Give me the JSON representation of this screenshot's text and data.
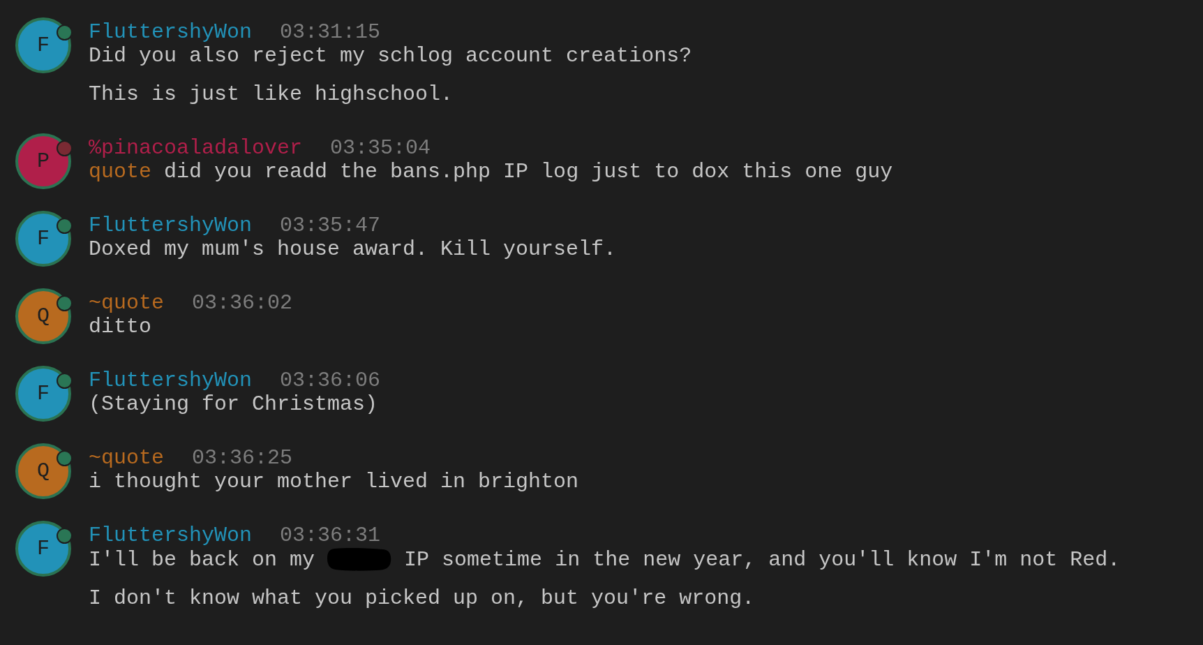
{
  "messages": [
    {
      "author": {
        "name": "FluttershyWon",
        "initial": "F",
        "color": "#2292b8"
      },
      "status_dot": {
        "color": "#2a7655"
      },
      "time": "03:31:15",
      "lines": [
        {
          "parts": [
            {
              "kind": "text",
              "text": "Did you also reject my schlog account creations?"
            }
          ]
        },
        {
          "parts": [
            {
              "kind": "text",
              "text": "This is just like highschool."
            }
          ]
        }
      ]
    },
    {
      "author": {
        "name": "%pinacoaladalover",
        "initial": "P",
        "color": "#b01f4a"
      },
      "status_dot": {
        "color": "#7a2a33"
      },
      "time": "03:35:04",
      "lines": [
        {
          "parts": [
            {
              "kind": "mention",
              "text": "quote",
              "color": "#b86a1f"
            },
            {
              "kind": "text",
              "text": "did you readd the bans.php IP log just to dox this one guy"
            }
          ]
        }
      ]
    },
    {
      "author": {
        "name": "FluttershyWon",
        "initial": "F",
        "color": "#2292b8"
      },
      "status_dot": {
        "color": "#2a7655"
      },
      "time": "03:35:47",
      "lines": [
        {
          "parts": [
            {
              "kind": "text",
              "text": "Doxed my mum's house award. Kill yourself."
            }
          ]
        }
      ]
    },
    {
      "author": {
        "name": "~quote",
        "initial": "Q",
        "color": "#b86a1f"
      },
      "status_dot": {
        "color": "#2a7655"
      },
      "time": "03:36:02",
      "lines": [
        {
          "parts": [
            {
              "kind": "text",
              "text": "ditto"
            }
          ]
        }
      ]
    },
    {
      "author": {
        "name": "FluttershyWon",
        "initial": "F",
        "color": "#2292b8"
      },
      "status_dot": {
        "color": "#2a7655"
      },
      "time": "03:36:06",
      "lines": [
        {
          "parts": [
            {
              "kind": "text",
              "text": "(Staying for Christmas)"
            }
          ]
        }
      ]
    },
    {
      "author": {
        "name": "~quote",
        "initial": "Q",
        "color": "#b86a1f"
      },
      "status_dot": {
        "color": "#2a7655"
      },
      "time": "03:36:25",
      "lines": [
        {
          "parts": [
            {
              "kind": "text",
              "text": "i thought your mother lived in brighton"
            }
          ]
        }
      ]
    },
    {
      "author": {
        "name": "FluttershyWon",
        "initial": "F",
        "color": "#2292b8"
      },
      "status_dot": {
        "color": "#2a7655"
      },
      "time": "03:36:31",
      "lines": [
        {
          "parts": [
            {
              "kind": "text",
              "text": "I'll be back on my"
            },
            {
              "kind": "redaction"
            },
            {
              "kind": "text",
              "text": "IP sometime in the new year, and you'll know I'm not Red."
            }
          ]
        },
        {
          "parts": [
            {
              "kind": "text",
              "text": "I don't know what you picked up on, but you're wrong."
            }
          ]
        }
      ]
    }
  ]
}
